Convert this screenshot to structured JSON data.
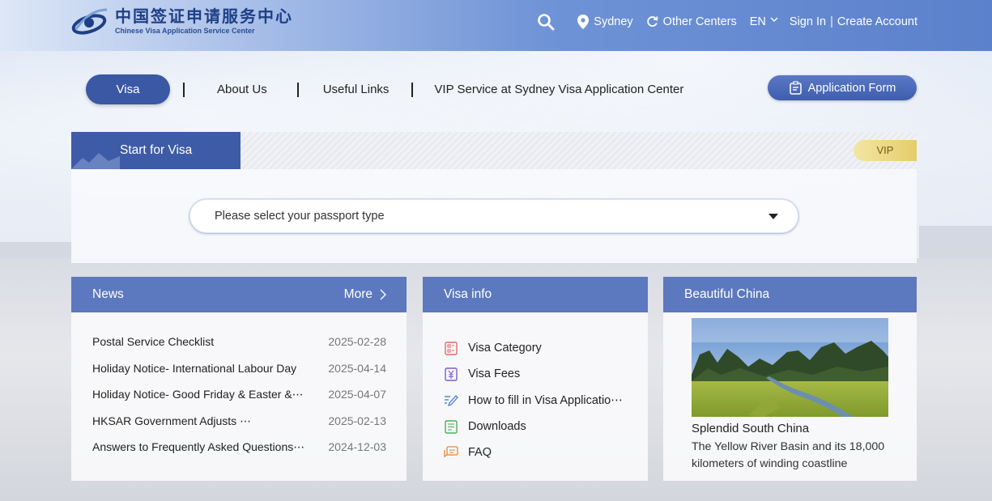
{
  "header": {
    "logo_cn": "中国签证申请服务中心",
    "logo_en": "Chinese Visa Application Service Center",
    "location": "Sydney",
    "other_centers": "Other Centers",
    "language": "EN",
    "sign_in": "Sign In",
    "separator": "|",
    "create_account": "Create Account",
    "icons": [
      "search-icon",
      "location-pin-icon",
      "refresh-icon",
      "chevron-down-icon"
    ]
  },
  "nav": {
    "items": [
      "Visa",
      "About Us",
      "Useful Links",
      "VIP Service at Sydney Visa Application Center"
    ],
    "active": "Visa",
    "separator": "|",
    "application_form": "Application Form"
  },
  "start": {
    "tab_label": "Start for Visa",
    "vip_label": "VIP",
    "passport_placeholder": "Please select your passport type"
  },
  "news": {
    "title": "News",
    "more": "More",
    "items": [
      {
        "title": "Postal Service Checklist",
        "date": "2025-02-28"
      },
      {
        "title": "Holiday Notice- International Labour Day",
        "date": "2025-04-14"
      },
      {
        "title": "Holiday Notice- Good Friday & Easter &⋯",
        "date": "2025-04-07"
      },
      {
        "title": "HKSAR  Government  Adjusts  ⋯",
        "date": "2025-02-13"
      },
      {
        "title": "Answers to Frequently Asked Questions⋯",
        "date": "2024-12-03"
      }
    ]
  },
  "visa_info": {
    "title": "Visa info",
    "items": [
      {
        "label": "Visa Category",
        "icon": "visa-category-icon"
      },
      {
        "label": "Visa Fees",
        "icon": "visa-fees-icon"
      },
      {
        "label": "How to fill in Visa Applicatio⋯",
        "icon": "pen-icon"
      },
      {
        "label": "Downloads",
        "icon": "document-icon"
      },
      {
        "label": "FAQ",
        "icon": "faq-icon"
      }
    ]
  },
  "china": {
    "title": "Beautiful China",
    "caption_title": "Splendid South China",
    "caption_text": "The Yellow River Basin and its 18,000 kilometers of winding coastline"
  },
  "colors": {
    "primary": "#3d5ba6",
    "panel_header": "#5c79bf",
    "vip_gold": "#e6cd6a"
  }
}
